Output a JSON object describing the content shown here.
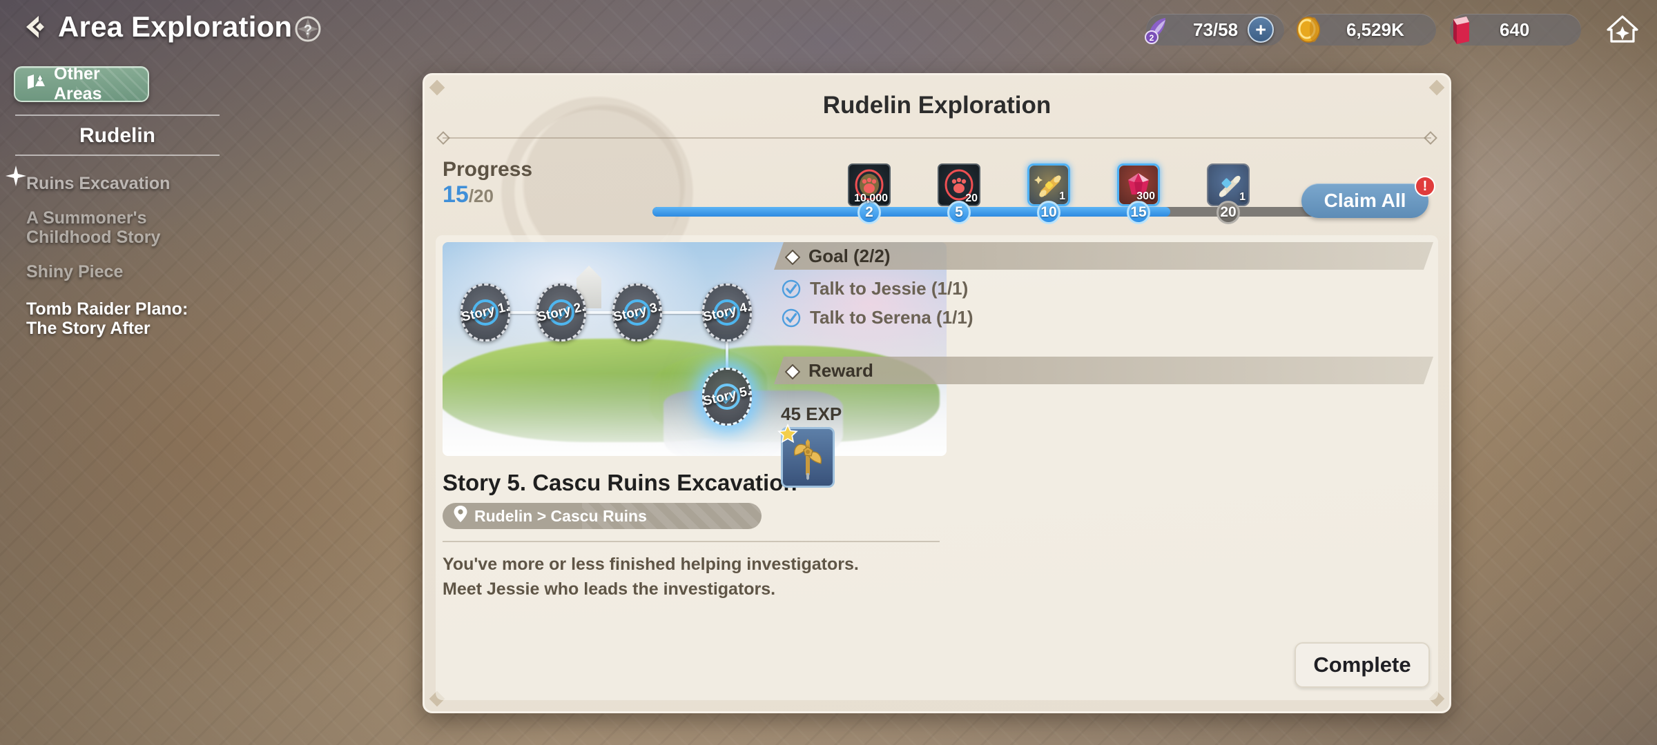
{
  "header": {
    "title": "Area Exploration",
    "back_icon": "back-arrow-icon",
    "help_icon": "help-question-icon",
    "home_icon": "home-icon"
  },
  "currencies": [
    {
      "id": "stamina",
      "icon": "stamina-feather-icon",
      "value": "73/58",
      "plus_label": "+"
    },
    {
      "id": "gold",
      "icon": "gold-coin-icon",
      "value": "6,529K"
    },
    {
      "id": "book",
      "icon": "red-book-icon",
      "value": "640"
    }
  ],
  "sidebar": {
    "other_areas_label": "Other Areas",
    "other_areas_icon": "map-flag-icon",
    "area_name": "Rudelin",
    "items": [
      {
        "label": "Ruins Excavation",
        "state": "selected",
        "icon": "sparkle-icon"
      },
      {
        "label": "A Summoner's Childhood Story",
        "state": "normal"
      },
      {
        "label": "Shiny Piece",
        "state": "normal"
      },
      {
        "label": "Tomb Raider Plano: The Story After",
        "state": "active"
      }
    ]
  },
  "panel": {
    "title": "Rudelin Exploration",
    "progress": {
      "label": "Progress",
      "current": "15",
      "total": "/20",
      "fill_percent": 75,
      "milestones": [
        {
          "step": "2",
          "position": 10.5,
          "state": "on",
          "item_icon": "red-paw-medal-icon",
          "qty": "10,000",
          "tier": "dark",
          "claimed": true
        },
        {
          "step": "5",
          "position": 23.5,
          "state": "on",
          "item_icon": "red-paw-medal-icon",
          "qty": "20",
          "tier": "dark",
          "claimed": true
        },
        {
          "step": "10",
          "position": 36.5,
          "state": "on",
          "item_icon": "gold-scroll-icon",
          "qty": "1",
          "tier": "gold",
          "claimed": false
        },
        {
          "step": "15",
          "position": 49.5,
          "state": "on",
          "item_icon": "red-gem-icon",
          "qty": "300",
          "tier": "red",
          "claimed": false
        },
        {
          "step": "20",
          "position": 62.5,
          "state": "off",
          "item_icon": "blue-scroll-icon",
          "qty": "1",
          "tier": "blue",
          "claimed": false
        }
      ]
    },
    "claim_all": {
      "label": "Claim All",
      "badge": "!"
    }
  },
  "story_map": {
    "nodes": [
      {
        "label": "Story 1.",
        "state": "completed"
      },
      {
        "label": "Story 2.",
        "state": "completed"
      },
      {
        "label": "Story 3.",
        "state": "completed"
      },
      {
        "label": "Story 4.",
        "state": "completed"
      },
      {
        "label": "Story 5.",
        "state": "current"
      }
    ]
  },
  "story": {
    "title": "Story 5. Cascu Ruins Excavation",
    "location_icon": "map-pin-icon",
    "location": "Rudelin > Cascu Ruins",
    "description": "You've more or less finished helping investigators.\nMeet Jessie who leads the investigators."
  },
  "goal": {
    "heading": "Goal (2/2)",
    "heading_icon": "diamond-icon",
    "objectives": [
      {
        "label": "Talk to Jessie (1/1)",
        "icon": "check-circle-icon",
        "done": true
      },
      {
        "label": "Talk to Serena (1/1)",
        "icon": "check-circle-icon",
        "done": true
      }
    ]
  },
  "reward": {
    "heading": "Reward",
    "heading_icon": "diamond-icon",
    "exp": "45 EXP",
    "item_icon": "golden-axe-icon",
    "item_badge_icon": "star-badge-icon"
  },
  "actions": {
    "complete_label": "Complete"
  },
  "colors": {
    "accent_blue": "#3f8fd8",
    "claim_blue": "#5d8cb6",
    "badge_red": "#e03c3c",
    "green_button": "#6e9780",
    "panel_cream": "#eae2d5"
  }
}
